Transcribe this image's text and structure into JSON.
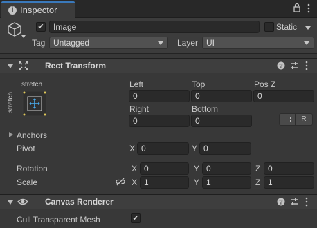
{
  "tab": {
    "label": "Inspector",
    "info_icon": "i",
    "lock_icon": "lock-icon",
    "more_icon": "kebab-menu-icon"
  },
  "gameobject": {
    "active": true,
    "name": "Image",
    "static_label": "Static",
    "static_checked": false,
    "tag_label": "Tag",
    "tag_value": "Untagged",
    "layer_label": "Layer",
    "layer_value": "UI"
  },
  "rect_transform": {
    "title": "Rect Transform",
    "anchor_preset_top": "stretch",
    "anchor_preset_side": "stretch",
    "row1": {
      "left_label": "Left",
      "left_value": "0",
      "top_label": "Top",
      "top_value": "0",
      "posz_label": "Pos Z",
      "posz_value": "0"
    },
    "row2": {
      "right_label": "Right",
      "right_value": "0",
      "bottom_label": "Bottom",
      "bottom_value": "0"
    },
    "raw_button": "R",
    "anchors_label": "Anchors",
    "pivot": {
      "label": "Pivot",
      "x_label": "X",
      "x": "0",
      "y_label": "Y",
      "y": "0"
    },
    "rotation": {
      "label": "Rotation",
      "x_label": "X",
      "x": "0",
      "y_label": "Y",
      "y": "0",
      "z_label": "Z",
      "z": "0"
    },
    "scale": {
      "label": "Scale",
      "x_label": "X",
      "x": "1",
      "y_label": "Y",
      "y": "1",
      "z_label": "Z",
      "z": "1"
    }
  },
  "canvas_renderer": {
    "title": "Canvas Renderer",
    "cull_label": "Cull Transparent Mesh",
    "cull_checked": true
  },
  "colors": {
    "panel": "#383838",
    "field": "#2a2a2a",
    "accent": "#3a79bb",
    "anchor_blue": "#4aa8e8"
  }
}
